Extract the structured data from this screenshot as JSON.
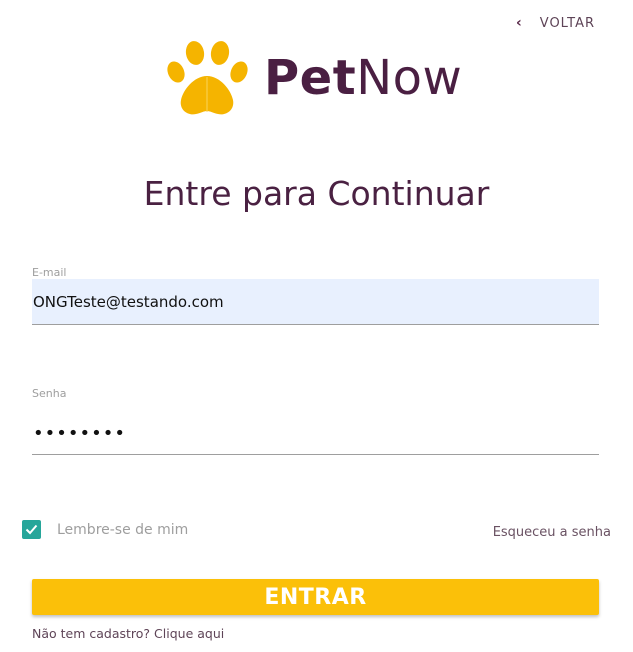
{
  "nav": {
    "back_icon": "chevron-left-icon",
    "back_label": "VOLTAR"
  },
  "brand": {
    "logo_icon": "paw-icon",
    "name_part1": "Pet",
    "name_part2": "Now",
    "colors": {
      "paw": "#f5b400",
      "text": "#4a1f42"
    }
  },
  "form": {
    "title": "Entre para Continuar",
    "email": {
      "label": "E-mail",
      "value": "ONGTeste@testando.com"
    },
    "password": {
      "label": "Senha",
      "value": "••••••••"
    },
    "remember": {
      "label": "Lembre-se de mim",
      "checked": true,
      "check_icon": "checkmark-icon",
      "color": "#26a69a"
    },
    "forgot_label": "Esqueceu a senha",
    "submit_label": "ENTRAR",
    "submit_color": "#fbc009",
    "signup_label": "Não tem cadastro? Clique aqui"
  }
}
